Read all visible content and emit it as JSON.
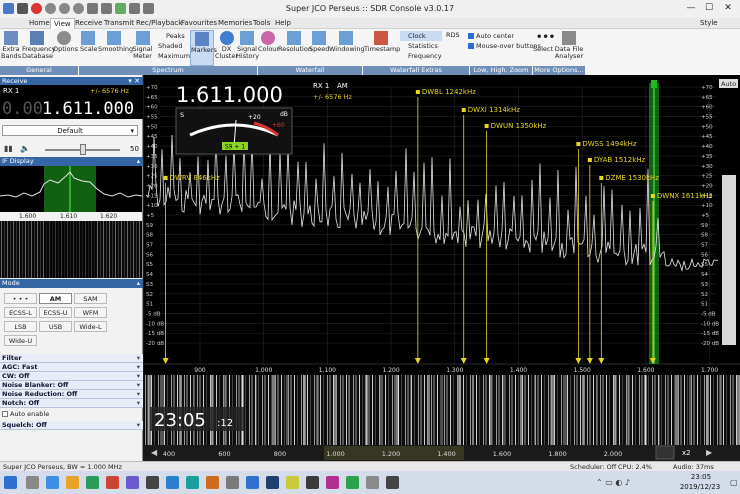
{
  "window": {
    "title": "Super JCO Perseus :: SDR Console v3.0.17",
    "style_label": "Style"
  },
  "menu": [
    "Home",
    "View",
    "Receive",
    "Transmit",
    "Rec/Playback",
    "Favourites",
    "Memories",
    "Tools",
    "Help"
  ],
  "menu_active": "View",
  "ribbon": {
    "general": {
      "label": "General",
      "items": [
        "Extra Bands",
        "Frequency Database",
        "Options"
      ]
    },
    "spectrum": {
      "label": "Spectrum",
      "items": [
        "Scale",
        "Smoothing",
        "Signal Meter",
        "Peaks",
        "Shaded",
        "Maximum",
        "Markers",
        "DX Cluster",
        "Signal History"
      ]
    },
    "waterfall": {
      "label": "Waterfall",
      "items": [
        "Colour",
        "Resolution",
        "Speed",
        "Windowing"
      ]
    },
    "waterfall_extras": {
      "label": "Waterfall Extras",
      "items": [
        "Timestamp",
        "Clock",
        "Statistics",
        "Frequency"
      ]
    },
    "low_high_zoom": {
      "label": "Low, High, Zoom",
      "items": [
        "RDS",
        "Auto center",
        "Mouse-over buttons"
      ]
    },
    "more": {
      "label": "More Options...",
      "items": [
        "Select",
        "Data File Analyser"
      ]
    }
  },
  "receive": {
    "header": "Receive",
    "rx": "RX 1",
    "offset": "+/- 6576 Hz",
    "freq_dim": "0.00",
    "freq": "1.611.000",
    "preset": "Default",
    "volume": "50"
  },
  "if_display": {
    "label": "IF Display",
    "ticks": [
      "1.600",
      "1.610",
      "1.620"
    ]
  },
  "mode": {
    "label": "Mode",
    "buttons": [
      "• • •",
      "AM",
      "SAM",
      "ECSS-L",
      "ECSS-U",
      "WFM",
      "LSB",
      "USB",
      "Wide-L",
      "Wide-U"
    ],
    "selected": "AM"
  },
  "sections": [
    "Filter",
    "AGC: Fast",
    "CW: Off",
    "Noise Blanker: Off",
    "Noise Reduction: Off",
    "Notch: Off",
    "Squelch: Off"
  ],
  "auto_enable": "Auto enable",
  "spectrum": {
    "freq": "1.611.000",
    "rx": "RX 1",
    "mode": "AM",
    "offset": "+/- 6576 Hz",
    "s_label": "S",
    "plus20": "+20",
    "plus60": "+60",
    "db": "dB",
    "s_reading": "S9 + 1",
    "auto": "Auto",
    "left_scale": [
      "+70",
      "+65",
      "+60",
      "+55",
      "+50",
      "+45",
      "+40",
      "+35",
      "+30",
      "+25",
      "+20",
      "+15",
      "+10",
      "+5",
      "S9",
      "S8",
      "S7",
      "S6",
      "S5",
      "S4",
      "S3",
      "S2",
      "S1",
      "-5 dB",
      "-10 dB",
      "-15 dB",
      "-20 dB"
    ],
    "right_scale": [
      "+70",
      "+65",
      "+60",
      "+55",
      "+50",
      "+45",
      "+40",
      "+35",
      "+30",
      "+25",
      "+20",
      "+15",
      "+10",
      "+5",
      "S9",
      "S8",
      "S7",
      "S6",
      "S5",
      "S4",
      "S3",
      "S2",
      "S1",
      "-5 dB",
      "-10 dB",
      "-15 dB",
      "-20 dB"
    ],
    "axis": [
      "900",
      "1.000",
      "1.100",
      "1.200",
      "1.300",
      "1.400",
      "1.500",
      "1.600",
      "1.700"
    ]
  },
  "markers": [
    {
      "label": "DWRV 846kHz",
      "khz": 846
    },
    {
      "label": "DWBL 1242kHz",
      "khz": 1242
    },
    {
      "label": "DWXI 1314kHz",
      "khz": 1314
    },
    {
      "label": "DWUN 1350kHz",
      "khz": 1350
    },
    {
      "label": "DWSS 1494kHz",
      "khz": 1494
    },
    {
      "label": "DYAB 1512kHz",
      "khz": 1512
    },
    {
      "label": "DZME 1530kHz",
      "khz": 1530
    },
    {
      "label": "DWNX 1611kHz",
      "khz": 1611
    }
  ],
  "waterfall": {
    "clock": "23:05",
    "clock_sec": ":12",
    "axis": [
      "400",
      "600",
      "800",
      "1.000",
      "1.200",
      "1.400",
      "1.600",
      "1.800",
      "2.000"
    ],
    "zoom": "x2"
  },
  "status": {
    "left": "Super JCO Perseus, BW = 1.000 MHz",
    "scheduler": "Scheduler: Off",
    "cpu": "CPU: 2.4%",
    "audio": "Audio: 37ms"
  },
  "taskbar": {
    "time": "23:05",
    "date": "2019/12/23"
  },
  "colors": {
    "accent": "#3465a4",
    "marker": "#e6d71f",
    "trace": "#e6e6e6",
    "selection": "#24c224"
  }
}
